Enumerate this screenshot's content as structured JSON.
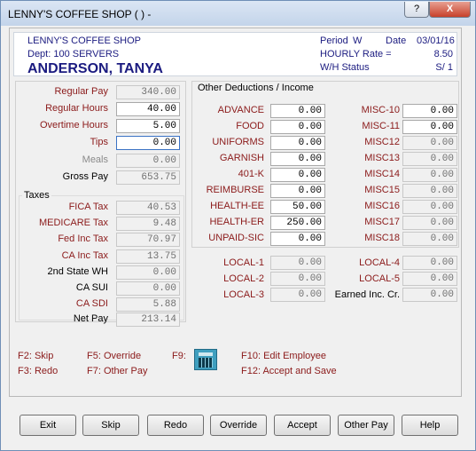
{
  "window": {
    "title": "LENNY'S COFFEE SHOP (  )   -",
    "help_label": "?",
    "close_label": "X"
  },
  "header": {
    "company": "LENNY'S COFFEE SHOP",
    "dept": "Dept:  100  SERVERS",
    "employee": "ANDERSON, TANYA",
    "period_label": "Period",
    "period_value": "W",
    "date_label": "Date",
    "date_value": "03/01/16",
    "hourly_label": "HOURLY Rate =",
    "hourly_value": "8.50",
    "wh_label": "W/H Status",
    "wh_value": "S/ 1"
  },
  "pay": {
    "regular_pay_label": "Regular Pay",
    "regular_pay": "340.00",
    "regular_hours_label": "Regular Hours",
    "regular_hours": "40.00",
    "overtime_hours_label": "Overtime Hours",
    "overtime_hours": "5.00",
    "tips_label": "Tips",
    "tips": "0.00",
    "meals_label": "Meals",
    "meals": "0.00",
    "gross_pay_label": "Gross Pay",
    "gross_pay": "653.75"
  },
  "taxes": {
    "group_label": "Taxes",
    "fica_label": "FICA Tax",
    "fica": "40.53",
    "medicare_label": "MEDICARE Tax",
    "medicare": "9.48",
    "fed_label": "Fed Inc Tax",
    "fed": "70.97",
    "ca_label": "CA Inc Tax",
    "ca": "13.75",
    "state2_label": "2nd State WH",
    "state2": "0.00",
    "casui_label": "CA SUI",
    "casui": "0.00",
    "casdi_label": "CA SDI",
    "casdi": "5.88",
    "net_label": "Net Pay",
    "net": "213.14"
  },
  "deductions": {
    "group_label": "Other Deductions / Income",
    "left": [
      {
        "label": "ADVANCE",
        "value": "0.00"
      },
      {
        "label": "FOOD",
        "value": "0.00"
      },
      {
        "label": "UNIFORMS",
        "value": "0.00"
      },
      {
        "label": "GARNISH",
        "value": "0.00"
      },
      {
        "label": "401-K",
        "value": "0.00"
      },
      {
        "label": "REIMBURSE",
        "value": "0.00"
      },
      {
        "label": "HEALTH-EE",
        "value": "50.00"
      },
      {
        "label": "HEALTH-ER",
        "value": "250.00"
      },
      {
        "label": "UNPAID-SIC",
        "value": "0.00"
      }
    ],
    "right": [
      {
        "label": "MISC-10",
        "value": "0.00"
      },
      {
        "label": "MISC-11",
        "value": "0.00"
      },
      {
        "label": "MISC12",
        "value": "0.00"
      },
      {
        "label": "MISC13",
        "value": "0.00"
      },
      {
        "label": "MISC14",
        "value": "0.00"
      },
      {
        "label": "MISC15",
        "value": "0.00"
      },
      {
        "label": "MISC16",
        "value": "0.00"
      },
      {
        "label": "MISC17",
        "value": "0.00"
      },
      {
        "label": "MISC18",
        "value": "0.00"
      }
    ]
  },
  "locals": {
    "local1_label": "LOCAL-1",
    "local1": "0.00",
    "local2_label": "LOCAL-2",
    "local2": "0.00",
    "local3_label": "LOCAL-3",
    "local3": "0.00",
    "local4_label": "LOCAL-4",
    "local4": "0.00",
    "local5_label": "LOCAL-5",
    "local5": "0.00",
    "eic_label": "Earned Inc. Cr.",
    "eic": "0.00"
  },
  "fkeys": {
    "f2": "F2: Skip",
    "f3": "F3: Redo",
    "f5": "F5: Override",
    "f7": "F7: Other Pay",
    "f9": "F9:",
    "f10": "F10: Edit Employee",
    "f12": "F12: Accept and Save"
  },
  "buttons": {
    "exit": "Exit",
    "skip": "Skip",
    "redo": "Redo",
    "override": "Override",
    "accept": "Accept",
    "other_pay": "Other Pay",
    "help": "Help"
  },
  "colors": {
    "label_red": "#8b1a1a",
    "header_blue": "#1b1b80",
    "close_red": "#c7412a"
  }
}
